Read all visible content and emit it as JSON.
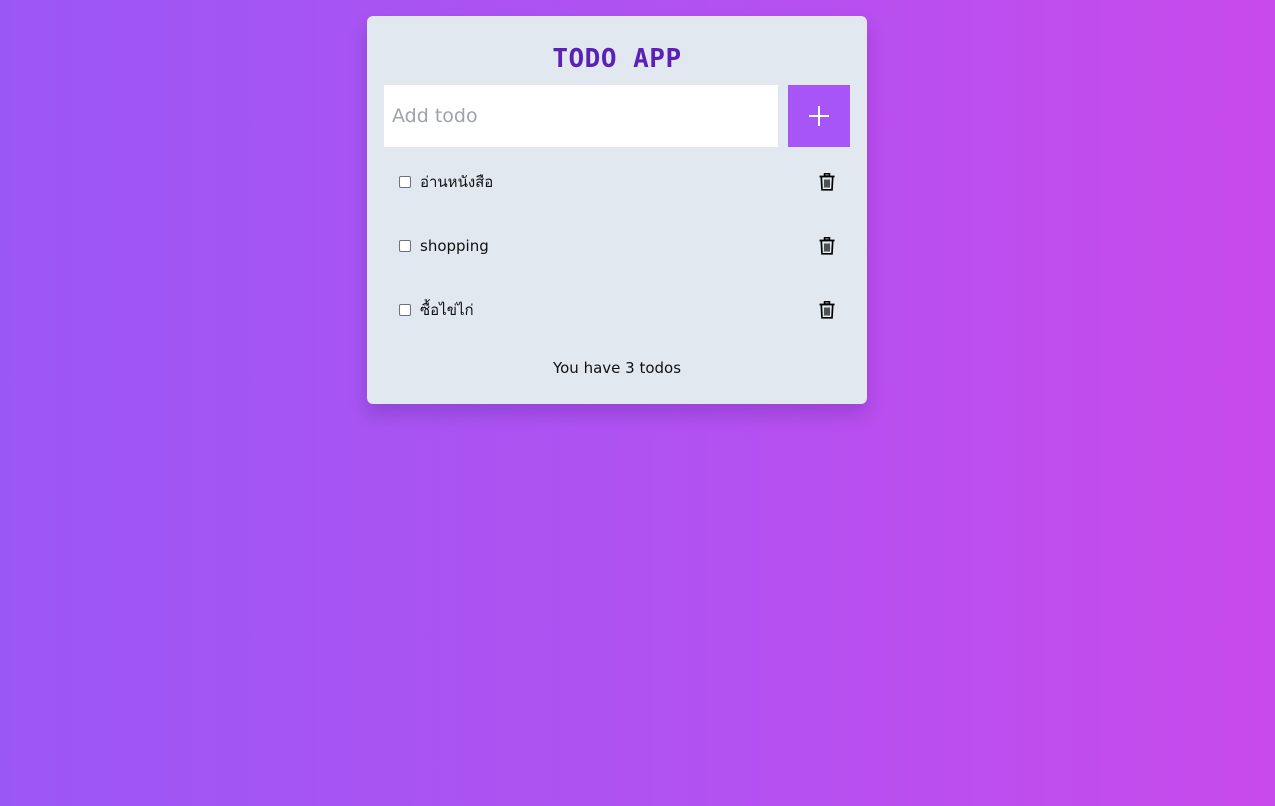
{
  "app": {
    "title": "TODO APP",
    "accent_color": "#a855f7",
    "title_color": "#5b21b6",
    "card_color": "#e2e8f0"
  },
  "input": {
    "placeholder": "Add todo",
    "value": ""
  },
  "add_button": {
    "icon": "plus-icon"
  },
  "todos": [
    {
      "text": "อ่านหนังสือ",
      "done": false,
      "delete_icon": "trash-icon"
    },
    {
      "text": "shopping",
      "done": false,
      "delete_icon": "trash-icon"
    },
    {
      "text": "ซื้อไข่ไก่",
      "done": false,
      "delete_icon": "trash-icon"
    }
  ],
  "footer": {
    "count_text": "You have 3 todos"
  }
}
